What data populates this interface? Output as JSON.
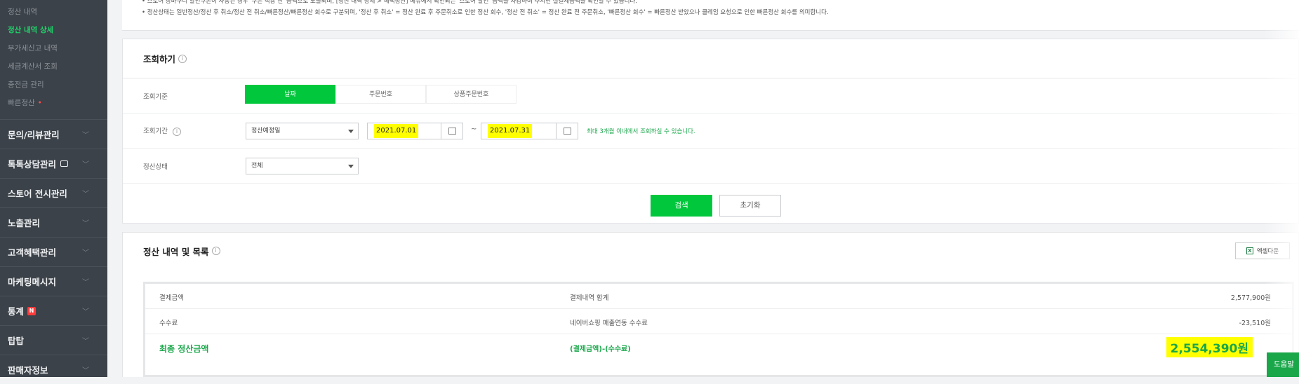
{
  "sidebar": {
    "sub_items": [
      {
        "label": "정산 내역",
        "active": false
      },
      {
        "label": "정산 내역 상세",
        "active": true
      },
      {
        "label": "부가세신고 내역",
        "active": false
      },
      {
        "label": "세금계산서 조회",
        "active": false
      },
      {
        "label": "충전금 관리",
        "active": false
      },
      {
        "label": "빠른정산",
        "active": false,
        "dot": "•"
      }
    ],
    "menus": [
      {
        "label": "문의/리뷰관리"
      },
      {
        "label": "톡톡상담관리"
      },
      {
        "label": "스토어 전시관리"
      },
      {
        "label": "노출관리"
      },
      {
        "label": "고객혜택관리"
      },
      {
        "label": "마케팅메시지"
      },
      {
        "label": "통계",
        "badge": "N"
      },
      {
        "label": "탑탑"
      },
      {
        "label": "판매자정보"
      }
    ]
  },
  "notice": {
    "line1": "• 스토어 장바구니 할인쿠폰이 사용된 경우 '쿠폰 적용 전' 금액으로 노출되며, [정산 내역 상세 > 혜택정산] 메뉴에서 확인되는 '스토어 할인' 금액을 차감하여 주시면 실결제금액을 확인할 수 있습니다.",
    "line2": "• 정산상태는 일반정산/정산 후 취소/정산 전 취소/빠른정산/빠른정산 회수로 구분되며, '정산 후 취소' = 정산 완료 후 주문취소로 인한 정산 회수, '정산 전 취소' = 정산 완료 전 주문취소, '빠른정산 회수' = 빠른정산 받았으나 클레임 요청으로 인한 빠른정산 회수를 의미합니다."
  },
  "search": {
    "title": "조회하기",
    "criteria_label": "조회기준",
    "criteria_options": [
      "날짜",
      "주문번호",
      "상품주문번호"
    ],
    "period_label": "조회기간",
    "date_type": "정산예정일",
    "start_date": "2021.07.01",
    "end_date": "2021.07.31",
    "tilde": "~",
    "hint": "최대 3개월 이내에서 조회하실 수 있습니다.",
    "status_label": "정산상태",
    "status_value": "전체",
    "search_btn": "검색",
    "reset_btn": "초기화"
  },
  "list": {
    "title": "정산 내역 및 목록",
    "excel_btn": "엑셀다운",
    "rows": [
      {
        "label": "결제금액",
        "desc": "결제내역 합계",
        "amount": "2,577,900원"
      },
      {
        "label": "수수료",
        "desc": "네이버쇼핑 매출연동 수수료",
        "amount": "-23,510원"
      }
    ],
    "final": {
      "label": "최종 정산금액",
      "desc": "(결제금액)-(수수료)",
      "amount": "2,554,390원"
    }
  },
  "help_btn": "도움말",
  "colors": {
    "accent": "#00c73c",
    "highlight": "#ffff00",
    "sidebar_bg": "#3c4249"
  }
}
